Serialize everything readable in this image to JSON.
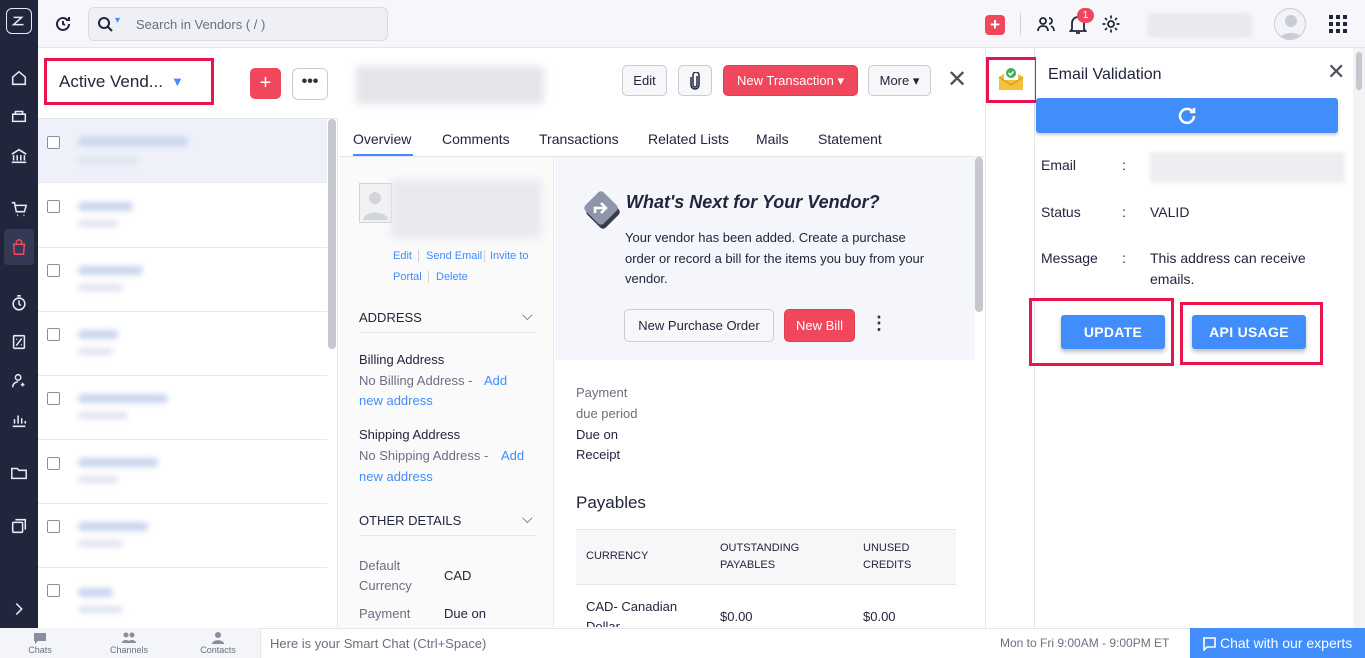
{
  "search": {
    "placeholder": "Search in Vendors ( / )"
  },
  "topbar": {
    "notification_count": "1"
  },
  "list": {
    "view_title": "Active Vend...",
    "add_label": "+",
    "more_label": "•••",
    "rows": 8
  },
  "detail": {
    "buttons": {
      "edit": "Edit",
      "new_transaction": "New Transaction ▾",
      "more": "More ▾"
    },
    "close": "✕",
    "tabs": [
      "Overview",
      "Comments",
      "Transactions",
      "Related Lists",
      "Mails",
      "Statement"
    ],
    "contact_links": {
      "edit": "Edit",
      "send_email": "Send Email",
      "invite": "Invite to",
      "portal": "Portal",
      "delete": "Delete"
    },
    "address": {
      "section": "ADDRESS",
      "billing_label": "Billing Address",
      "billing_value": "No Billing Address -",
      "billing_link_a": "Add",
      "billing_link_b": "new address",
      "shipping_label": "Shipping Address",
      "shipping_value": "No Shipping Address -",
      "shipping_link_a": "Add",
      "shipping_link_b": "new address"
    },
    "other": {
      "section": "OTHER DETAILS",
      "currency_label_a": "Default",
      "currency_label_b": "Currency",
      "currency_value": "CAD",
      "payment_label": "Payment",
      "payment_value": "Due on"
    },
    "whats_next": {
      "title": "What's Next for Your Vendor?",
      "line1": "Your vendor has been added. Create a purchase",
      "line2": "order or record a bill for the items you buy from your",
      "line3": "vendor.",
      "btn_po": "New Purchase Order",
      "btn_bill": "New Bill"
    },
    "payment_due": {
      "l1": "Payment",
      "l2": "due period",
      "v1": "Due on",
      "v2": "Receipt"
    },
    "payables": {
      "title": "Payables",
      "headers": [
        [
          "CURRENCY",
          ""
        ],
        [
          "OUTSTANDING",
          "PAYABLES"
        ],
        [
          "UNUSED",
          "CREDITS"
        ]
      ],
      "row": {
        "currency_a": "CAD- Canadian",
        "currency_b": "Dollar",
        "outstanding": "$0.00",
        "unused": "$0.00"
      }
    }
  },
  "panel": {
    "title": "Email Validation",
    "close": "✕",
    "email_label": "Email",
    "status_label": "Status",
    "status_value": "VALID",
    "message_label": "Message",
    "message_l1": "This address can receive",
    "message_l2": "emails.",
    "colon": ":",
    "update": "UPDATE",
    "api_usage": "API USAGE"
  },
  "bottom": {
    "chats": "Chats",
    "channels": "Channels",
    "contacts": "Contacts",
    "smart_chat": "Here is your Smart Chat (Ctrl+Space)",
    "hours": "Mon to Fri 9:00AM - 9:00PM ET",
    "chat_btn": "Chat with our experts"
  },
  "colors": {
    "accent": "#408dfb",
    "danger": "#f0475c",
    "rail": "#21263c",
    "highlight": "#e8144b"
  },
  "icons": [
    "app-logo-icon",
    "home-icon",
    "items-icon",
    "banking-icon",
    "sales-icon",
    "purchases-icon",
    "time-icon",
    "accountant-icon",
    "users-icon",
    "reports-icon",
    "documents-icon",
    "integrations-icon",
    "expand-icon",
    "refresh-icon",
    "search-icon",
    "add-icon",
    "team-icon",
    "bell-icon",
    "gear-icon",
    "apps-grid-icon",
    "attach-icon",
    "share-arrow-icon",
    "email-validation-icon",
    "refresh-circle-icon",
    "chat-icon"
  ]
}
